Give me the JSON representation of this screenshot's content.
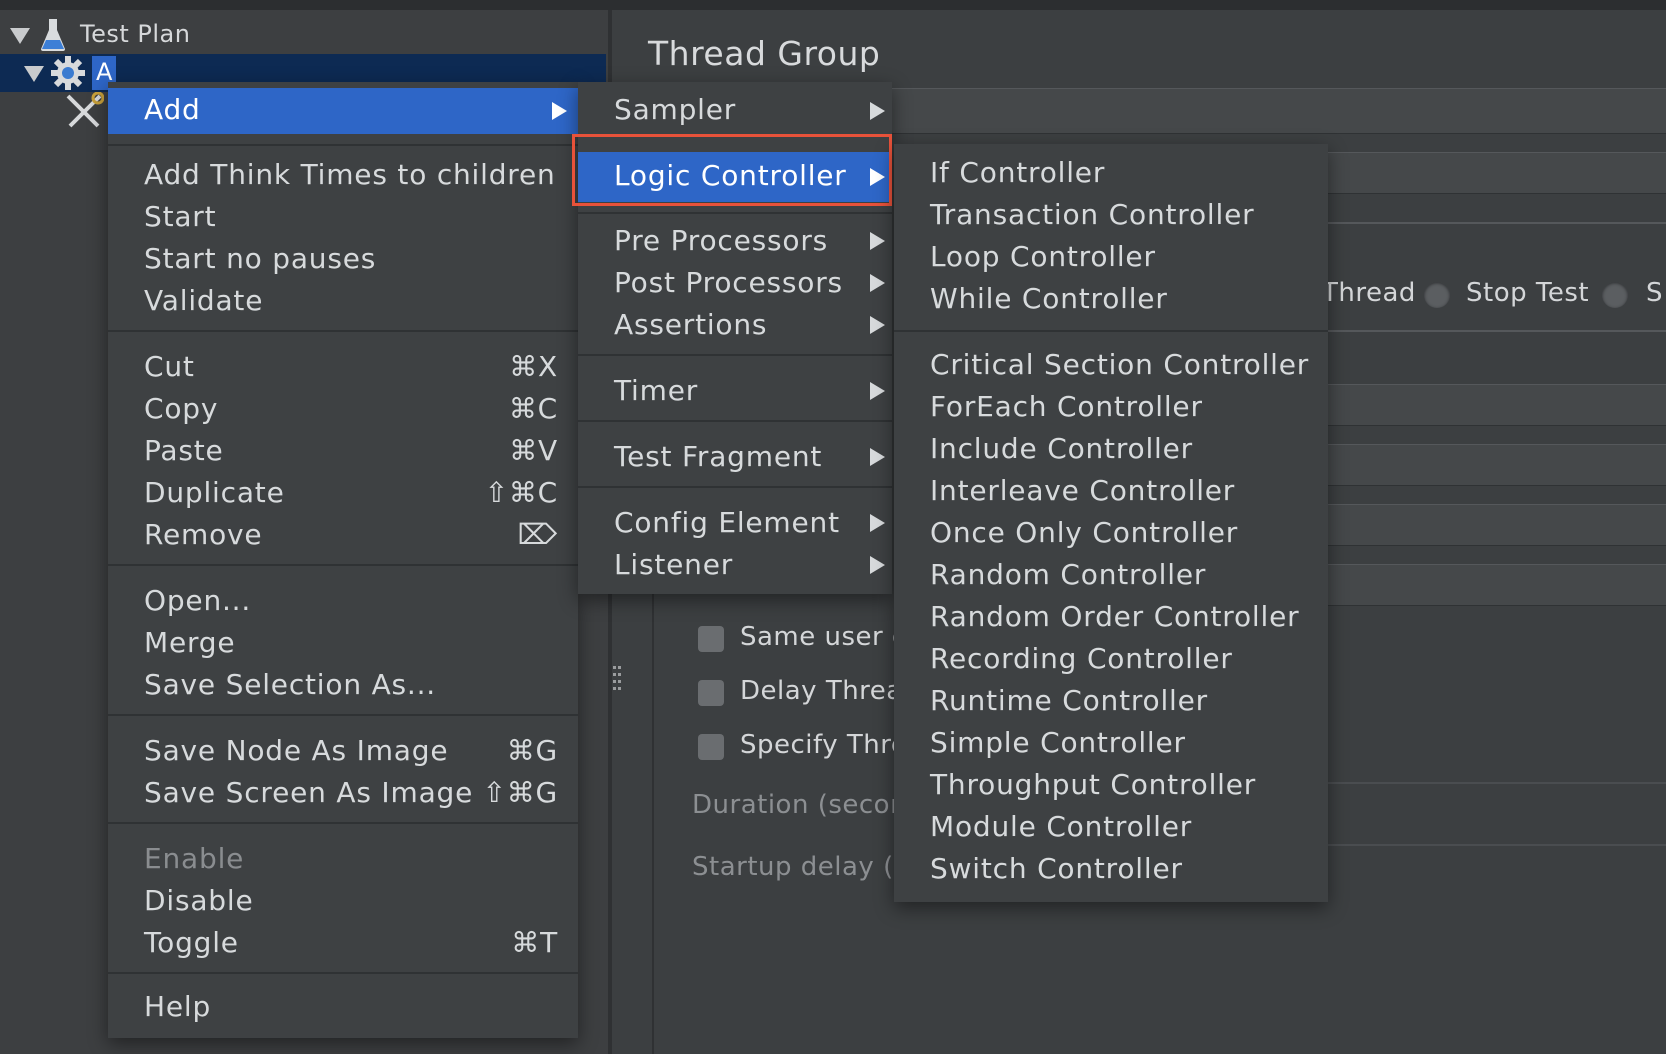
{
  "tree": {
    "test_plan_label": "Test Plan",
    "thread_group_label": "A"
  },
  "thread_group": {
    "title": "Thread Group",
    "action_radios": [
      "Thread",
      "Stop Test",
      "S"
    ],
    "checkboxes": [
      "Same user o",
      "Delay Threa",
      "Specify Thre"
    ],
    "duration_label": "Duration (secon",
    "startup_delay_label": "Startup delay (se"
  },
  "context_menu": {
    "add": "Add",
    "add_think_times": "Add Think Times to children",
    "start": "Start",
    "start_no_pauses": "Start no pauses",
    "validate": "Validate",
    "cut": "Cut",
    "cut_sc": "⌘X",
    "copy": "Copy",
    "copy_sc": "⌘C",
    "paste": "Paste",
    "paste_sc": "⌘V",
    "duplicate": "Duplicate",
    "duplicate_sc": "⇧⌘C",
    "remove": "Remove",
    "remove_sc": "⌦",
    "open": "Open...",
    "merge": "Merge",
    "save_selection_as": "Save Selection As...",
    "save_node_as_image": "Save Node As Image",
    "save_node_sc": "⌘G",
    "save_screen_as_image": "Save Screen As Image",
    "save_screen_sc": "⇧⌘G",
    "enable": "Enable",
    "disable": "Disable",
    "toggle": "Toggle",
    "toggle_sc": "⌘T",
    "help": "Help"
  },
  "add_submenu": {
    "sampler": "Sampler",
    "logic_controller": "Logic Controller",
    "pre_processors": "Pre Processors",
    "post_processors": "Post Processors",
    "assertions": "Assertions",
    "timer": "Timer",
    "test_fragment": "Test Fragment",
    "config_element": "Config Element",
    "listener": "Listener"
  },
  "logic_controller_submenu": {
    "group1": [
      "If Controller",
      "Transaction Controller",
      "Loop Controller",
      "While Controller"
    ],
    "group2": [
      "Critical Section Controller",
      "ForEach Controller",
      "Include Controller",
      "Interleave Controller",
      "Once Only Controller",
      "Random Controller",
      "Random Order Controller",
      "Recording Controller",
      "Runtime Controller",
      "Simple Controller",
      "Throughput Controller",
      "Module Controller",
      "Switch Controller"
    ]
  },
  "colors": {
    "highlight": "#2e66c7",
    "callout_border": "#e8523a",
    "menu_bg": "#3e4143"
  }
}
